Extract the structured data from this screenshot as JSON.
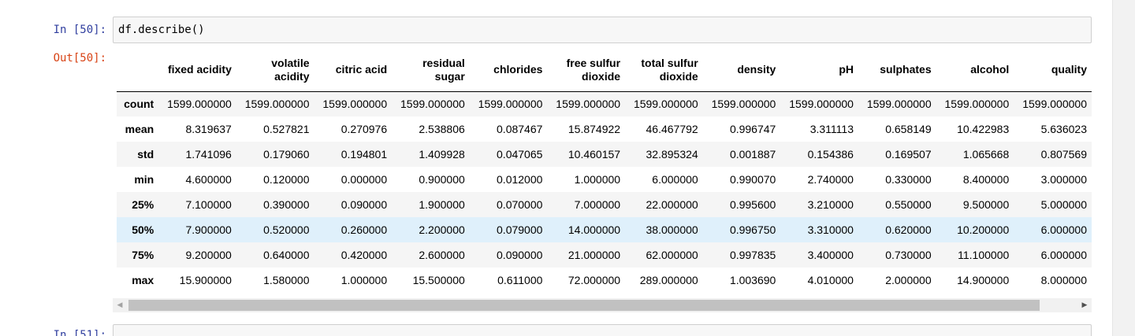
{
  "cell_in": {
    "prompt": "In [50]:",
    "code": "df.describe()"
  },
  "cell_out": {
    "prompt": "Out[50]:"
  },
  "next_cell": {
    "prompt": "In [51]:"
  },
  "table": {
    "columns": [
      [
        "fixed acidity"
      ],
      [
        "volatile",
        "acidity"
      ],
      [
        "citric acid"
      ],
      [
        "residual",
        "sugar"
      ],
      [
        "chlorides"
      ],
      [
        "free sulfur",
        "dioxide"
      ],
      [
        "total sulfur",
        "dioxide"
      ],
      [
        "density"
      ],
      [
        "pH"
      ],
      [
        "sulphates"
      ],
      [
        "alcohol"
      ],
      [
        "quality"
      ]
    ],
    "rows": [
      {
        "label": "count",
        "values": [
          "1599.000000",
          "1599.000000",
          "1599.000000",
          "1599.000000",
          "1599.000000",
          "1599.000000",
          "1599.000000",
          "1599.000000",
          "1599.000000",
          "1599.000000",
          "1599.000000",
          "1599.000000"
        ]
      },
      {
        "label": "mean",
        "values": [
          "8.319637",
          "0.527821",
          "0.270976",
          "2.538806",
          "0.087467",
          "15.874922",
          "46.467792",
          "0.996747",
          "3.311113",
          "0.658149",
          "10.422983",
          "5.636023"
        ]
      },
      {
        "label": "std",
        "values": [
          "1.741096",
          "0.179060",
          "0.194801",
          "1.409928",
          "0.047065",
          "10.460157",
          "32.895324",
          "0.001887",
          "0.154386",
          "0.169507",
          "1.065668",
          "0.807569"
        ]
      },
      {
        "label": "min",
        "values": [
          "4.600000",
          "0.120000",
          "0.000000",
          "0.900000",
          "0.012000",
          "1.000000",
          "6.000000",
          "0.990070",
          "2.740000",
          "0.330000",
          "8.400000",
          "3.000000"
        ]
      },
      {
        "label": "25%",
        "values": [
          "7.100000",
          "0.390000",
          "0.090000",
          "1.900000",
          "0.070000",
          "7.000000",
          "22.000000",
          "0.995600",
          "3.210000",
          "0.550000",
          "9.500000",
          "5.000000"
        ]
      },
      {
        "label": "50%",
        "values": [
          "7.900000",
          "0.520000",
          "0.260000",
          "2.200000",
          "0.079000",
          "14.000000",
          "38.000000",
          "0.996750",
          "3.310000",
          "0.620000",
          "10.200000",
          "6.000000"
        ]
      },
      {
        "label": "75%",
        "values": [
          "9.200000",
          "0.640000",
          "0.420000",
          "2.600000",
          "0.090000",
          "21.000000",
          "62.000000",
          "0.997835",
          "3.400000",
          "0.730000",
          "11.100000",
          "6.000000"
        ]
      },
      {
        "label": "max",
        "values": [
          "15.900000",
          "1.580000",
          "1.000000",
          "15.500000",
          "0.611000",
          "72.000000",
          "289.000000",
          "1.003690",
          "4.010000",
          "2.000000",
          "14.900000",
          "8.000000"
        ]
      }
    ],
    "highlight_row": "50%"
  },
  "scrollbar": {
    "left_arrow": "◀",
    "right_arrow": "▶"
  }
}
